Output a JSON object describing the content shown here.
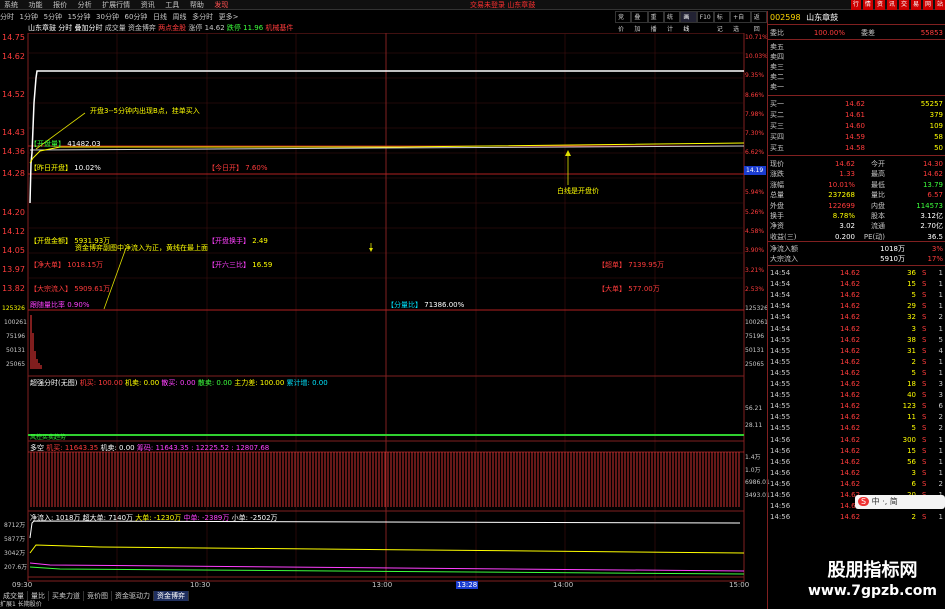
{
  "menu": {
    "items": [
      "系统",
      "功能",
      "报价",
      "分析",
      "扩展行情",
      "资讯",
      "工具",
      "帮助"
    ],
    "highlight": "发现"
  },
  "window_title": "交易未登录 山东章鼓",
  "top_right_buttons": [
    "行",
    "情",
    "资",
    "讯",
    "交",
    "易",
    "网",
    "站"
  ],
  "periods": [
    "分时",
    "1分钟",
    "5分钟",
    "15分钟",
    "30分钟",
    "60分钟",
    "日线",
    "周线",
    "多分时",
    "更多>"
  ],
  "toolbar2": {
    "items": [
      "竞价",
      "叠加",
      "重播",
      "统计",
      "画线",
      "F10",
      "标记",
      "+自选",
      "返回"
    ],
    "selected": "画线"
  },
  "subtitle": {
    "name": "山东章鼓",
    "modes": [
      "分时",
      "叠加分时",
      "成交量",
      "资金博弈"
    ],
    "tags": [
      "两点金股",
      "涨停 14.62",
      "跌停 11.96",
      "机械基件"
    ]
  },
  "colors": {
    "up": "#ff3c3c",
    "down": "#3cff3c",
    "yellow": "#ffff00",
    "grid": "#802020"
  },
  "price_axis": {
    "left": [
      "14.75",
      "14.62",
      "14.52",
      "14.43",
      "14.36",
      "14.28",
      "14.20",
      "14.12",
      "14.05",
      "13.97",
      "13.89",
      "13.82",
      "13.74",
      "13.66"
    ],
    "right": [
      "10.71%",
      "10.03%",
      "9.35%",
      "8.66%",
      "7.98%",
      "7.30%",
      "6.62%",
      "5.94%",
      "5.26%",
      "4.58%",
      "3.90%",
      "3.21%",
      "2.53%"
    ]
  },
  "vol_axis": {
    "left": [
      "125326",
      "100261",
      "75196",
      "50131",
      "25065"
    ],
    "right": [
      "125326",
      "100261",
      "75196",
      "50131",
      "25065"
    ]
  },
  "current_price_tag": "14.19",
  "annotations": {
    "open_note": "开盘3--5分钟内出现B点，挂单买入",
    "white_line_note": "白线是开盘价",
    "fund_note": "资金博弈副图中净流入为正，黄线在最上面"
  },
  "overlay_labels": {
    "open_amount": "【开盘量】",
    "open_amount_val": "41482.03",
    "prev_open": "【昨日开盘】",
    "prev_open_val": "10.02%",
    "today_open": "【今日开】",
    "today_open_val": "7.60%",
    "open_fund": "【开盘金额】",
    "open_fund_val": "5931.93万",
    "open_turnover": "【开盘换手】",
    "open_turnover_val": "2.49",
    "net_big": "【净大单】",
    "net_big_val": "1018.15万",
    "kaipan3": "【开六三比】",
    "kaipan3_val": "16.59",
    "big_inflow": "【大宗流入】",
    "big_inflow_val": "5909.61万",
    "super": "【超单】",
    "super_val": "7139.95万",
    "big_order": "【大单】",
    "big_order_val": "577.00万",
    "vol_pct": "跟随量比率",
    "vol_pct_val": "0.90%",
    "wave_ratio": "【分量比】",
    "wave_ratio_val": "71386.00%"
  },
  "panel2": {
    "title": "超强分时(无图)",
    "items": [
      "机买: 100.00",
      "机卖: 0.00",
      "散买: 0.00",
      "散卖: 0.00",
      "主力差: 100.00",
      "累计增: 0.00"
    ],
    "axis": [
      "56.21",
      "28.11"
    ],
    "footer": "风控买卖趋势"
  },
  "panel3": {
    "title": "多空",
    "items": [
      "机买: 11643.35",
      "机卖: 0.00",
      "筹码: 11643.35 : 12225.52 : 12807.68"
    ],
    "axis": [
      "1.4万",
      "1.0万",
      "6986.01",
      "3493.01"
    ]
  },
  "panel4": {
    "title": "净流入: 1018万",
    "items": [
      "超大单: 7140万",
      "大单: -1230万",
      "中单: -2389万",
      "小单: -2502万"
    ],
    "axis": [
      "8712万",
      "5877万",
      "3042万",
      "207.6万"
    ]
  },
  "time_axis": [
    "09:30",
    "10:30",
    "13:00",
    "13:28",
    "14:00",
    "15:00"
  ],
  "bottom_tabs": {
    "items": [
      "成交量",
      "量比",
      "买卖力道",
      "竞价图",
      "资金驱动力",
      "资金博弈"
    ],
    "selected": "资金博弈"
  },
  "status_bar": "扩展1  长期股价",
  "right_panel": {
    "code": "002598",
    "name": "山东章鼓",
    "ratio": {
      "label": "委比",
      "v1": "100.00%",
      "l2": "委差",
      "v2": "55853"
    },
    "asks": [
      "卖五",
      "卖四",
      "卖三",
      "卖二",
      "卖一"
    ],
    "bids": [
      {
        "l": "买一",
        "p": "14.62",
        "q": "55257"
      },
      {
        "l": "买二",
        "p": "14.61",
        "q": "379"
      },
      {
        "l": "买三",
        "p": "14.60",
        "q": "109"
      },
      {
        "l": "买四",
        "p": "14.59",
        "q": "58"
      },
      {
        "l": "买五",
        "p": "14.58",
        "q": "50"
      }
    ],
    "stats": [
      {
        "l": "现价",
        "v": "14.62",
        "l2": "今开",
        "v2": "14.30"
      },
      {
        "l": "涨跌",
        "v": "1.33",
        "l2": "最高",
        "v2": "14.62"
      },
      {
        "l": "涨幅",
        "v": "10.01%",
        "l2": "最低",
        "v2": "13.79"
      },
      {
        "l": "总量",
        "v": "237268",
        "l2": "量比",
        "v2": "6.57"
      },
      {
        "l": "外盘",
        "v": "122699",
        "l2": "内盘",
        "v2": "114573"
      },
      {
        "l": "换手",
        "v": "8.78%",
        "l2": "股本",
        "v2": "3.12亿"
      },
      {
        "l": "净资",
        "v": "3.02",
        "l2": "流通",
        "v2": "2.70亿"
      },
      {
        "l": "收益(三)",
        "v": "0.200",
        "l2": "PE(动)",
        "v2": "36.5"
      }
    ],
    "flows": [
      {
        "l": "净流入额",
        "v": "1018万",
        "v2": "3%"
      },
      {
        "l": "大宗流入",
        "v": "5910万",
        "v2": "17%"
      }
    ],
    "ticks": [
      {
        "t": "14:54",
        "p": "14.62",
        "q": "36",
        "s": "S",
        "n": "1"
      },
      {
        "t": "14:54",
        "p": "14.62",
        "q": "15",
        "s": "S",
        "n": "1"
      },
      {
        "t": "14:54",
        "p": "14.62",
        "q": "5",
        "s": "S",
        "n": "1"
      },
      {
        "t": "14:54",
        "p": "14.62",
        "q": "29",
        "s": "S",
        "n": "1"
      },
      {
        "t": "14:54",
        "p": "14.62",
        "q": "32",
        "s": "S",
        "n": "2"
      },
      {
        "t": "14:54",
        "p": "14.62",
        "q": "3",
        "s": "S",
        "n": "1"
      },
      {
        "t": "14:55",
        "p": "14.62",
        "q": "38",
        "s": "S",
        "n": "5"
      },
      {
        "t": "14:55",
        "p": "14.62",
        "q": "31",
        "s": "S",
        "n": "4"
      },
      {
        "t": "14:55",
        "p": "14.62",
        "q": "2",
        "s": "S",
        "n": "1"
      },
      {
        "t": "14:55",
        "p": "14.62",
        "q": "5",
        "s": "S",
        "n": "1"
      },
      {
        "t": "14:55",
        "p": "14.62",
        "q": "18",
        "s": "S",
        "n": "3"
      },
      {
        "t": "14:55",
        "p": "14.62",
        "q": "40",
        "s": "S",
        "n": "3"
      },
      {
        "t": "14:55",
        "p": "14.62",
        "q": "123",
        "s": "S",
        "n": "6"
      },
      {
        "t": "14:55",
        "p": "14.62",
        "q": "11",
        "s": "S",
        "n": "2"
      },
      {
        "t": "14:55",
        "p": "14.62",
        "q": "5",
        "s": "S",
        "n": "2"
      },
      {
        "t": "14:56",
        "p": "14.62",
        "q": "300",
        "s": "S",
        "n": "1"
      },
      {
        "t": "14:56",
        "p": "14.62",
        "q": "15",
        "s": "S",
        "n": "1"
      },
      {
        "t": "14:56",
        "p": "14.62",
        "q": "56",
        "s": "S",
        "n": "1"
      },
      {
        "t": "14:56",
        "p": "14.62",
        "q": "3",
        "s": "S",
        "n": "1"
      },
      {
        "t": "14:56",
        "p": "14.62",
        "q": "6",
        "s": "S",
        "n": "2"
      },
      {
        "t": "14:56",
        "p": "14.62",
        "q": "20",
        "s": "S",
        "n": "1"
      },
      {
        "t": "14:56",
        "p": "14.62",
        "q": "5",
        "s": "S",
        "n": "1"
      },
      {
        "t": "14:56",
        "p": "14.62",
        "q": "2",
        "s": "S",
        "n": "1"
      }
    ]
  },
  "watermark": {
    "line1": "股朋指标网",
    "line2": "www.7gpzb.com"
  },
  "ime": "中 ·, 简"
}
